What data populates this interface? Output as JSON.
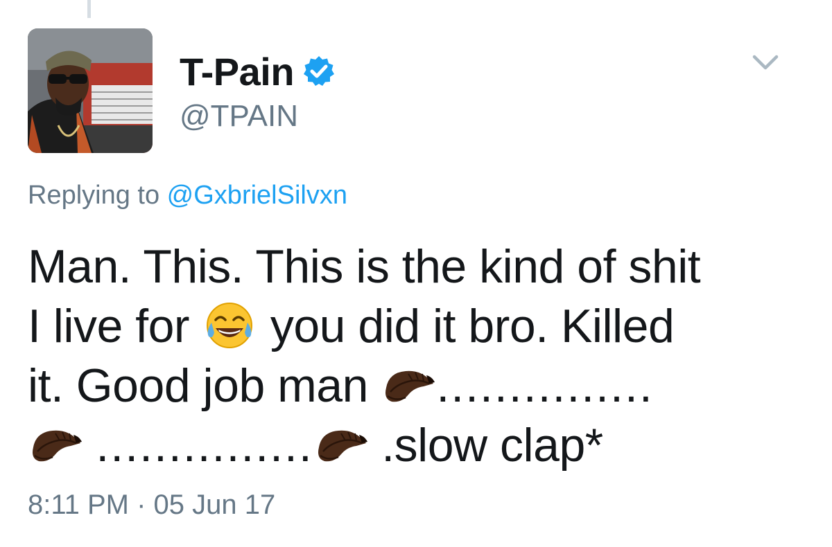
{
  "user": {
    "display_name": "T-Pain",
    "handle": "@TPAIN",
    "verified": true
  },
  "reply": {
    "prefix": "Replying to ",
    "mention": "@GxbrielSilvxn"
  },
  "text": {
    "line1": "Man. This. This is the kind of shit",
    "line2_a": "I live for ",
    "line2_b": " you did it bro. Killed",
    "line3_a": "it. Good job man ",
    "line3_b": "...............",
    "line4_a": "...............",
    "line4_b": ".slow clap*"
  },
  "timestamp": "8:11 PM · 05 Jun 17",
  "icons": {
    "verified": "verified-badge-icon",
    "menu": "chevron-down-icon",
    "laugh": "face-with-tears-of-joy-emoji",
    "clap": "clapping-hands-dark-skin-emoji"
  },
  "colors": {
    "verified_blue": "#1da1f2",
    "secondary_text": "#657786",
    "primary_text": "#14171a",
    "mention_blue": "#1da1f2"
  }
}
